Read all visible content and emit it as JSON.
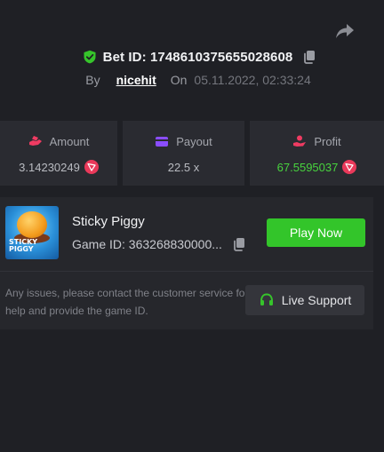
{
  "bet": {
    "id_text": "Bet ID: 1748610375655028608",
    "by_label": "By",
    "user": "nicehit",
    "on_label": "On",
    "datetime": "05.11.2022, 02:33:24"
  },
  "stats": [
    {
      "label": "Amount",
      "value": "3.14230249"
    },
    {
      "label": "Payout",
      "value": "22.5 x"
    },
    {
      "label": "Profit",
      "value": "67.5595037"
    }
  ],
  "game": {
    "title": "Sticky Piggy",
    "id_text": "Game ID: 363268830000...",
    "thumb_text_line1": "STICKY",
    "thumb_text_line2": "PIGGY",
    "play_label": "Play Now"
  },
  "support": {
    "help_text": "Any issues, please contact the customer service for help and provide the game ID.",
    "live_label": "Live Support"
  },
  "colors": {
    "verified": "#36c42b",
    "amount_icon": "#ef3b62",
    "payout_icon": "#8a4dff",
    "profit_icon": "#ef3b62",
    "profit_value": "#48d33e",
    "play_button": "#33c52a",
    "trx_coin": "#e9395a"
  },
  "icons": {
    "share": "share-arrow-icon",
    "verified": "shield-check-icon",
    "copy": "copy-icon",
    "amount": "money-hand-icon",
    "payout": "wallet-card-icon",
    "profit": "profit-hand-icon",
    "currency": "trx-coin-icon",
    "support": "headset-icon"
  }
}
